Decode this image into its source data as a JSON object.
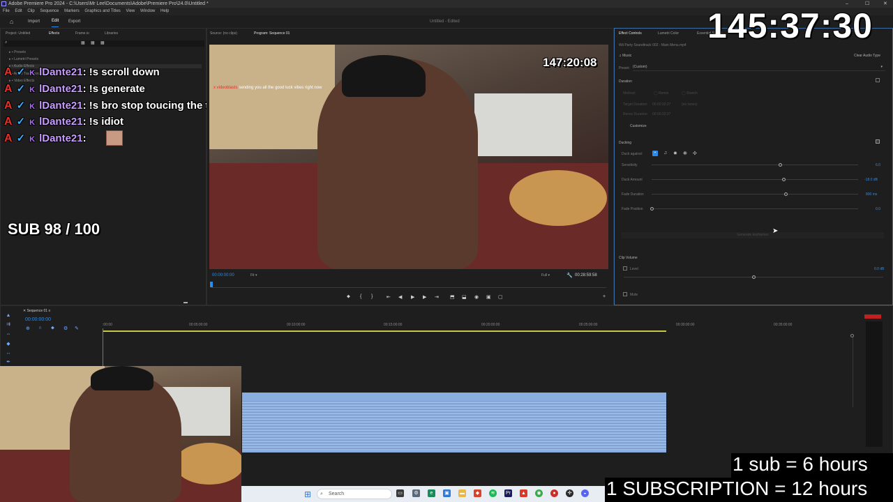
{
  "window": {
    "title": "Adobe Premiere Pro 2024 - C:\\Users\\Mr Lee\\Documents\\Adobe\\Premiere Pro\\24.0\\Untitled *",
    "controls": [
      "–",
      "☐",
      "✕"
    ]
  },
  "menu": [
    "File",
    "Edit",
    "Clip",
    "Sequence",
    "Markers",
    "Graphics and Titles",
    "View",
    "Window",
    "Help"
  ],
  "workspace": {
    "tabs": [
      "Import",
      "Edit",
      "Export"
    ],
    "active_tab": "Edit",
    "project_status": "Untitled - Edited"
  },
  "left_panel": {
    "tabs": [
      "Project: Untitled",
      "Effects",
      "Frame.io",
      "Libraries"
    ],
    "active_tab": "Effects",
    "tree": [
      "Presets",
      "Lumetri Presets",
      "Audio Effects",
      "Audio Transitions",
      "Video Effects"
    ]
  },
  "chat": [
    {
      "user": "lDante21",
      "message": "!s scroll down"
    },
    {
      "user": "lDante21",
      "message": "!s generate"
    },
    {
      "user": "lDante21",
      "message": "!s bro stop toucing the things LMAO u messed it up"
    },
    {
      "user": "lDante21",
      "message": "!s idiot"
    },
    {
      "user": "lDante21",
      "message": ""
    }
  ],
  "sub_goal": "SUB 98 / 100",
  "stream_timer": "145:37:30",
  "monitor": {
    "tabs": [
      "Source: (no clips)",
      "Program: Sequence 01"
    ],
    "active_tab": "Program: Sequence 01",
    "video_timer": "147:20:08",
    "video_alert_user": "x videoblasts",
    "video_alert_text": "sending you all the good luck vibes right now",
    "playhead_time": "00:00:00:00",
    "fit": "Fit",
    "quality": "Full",
    "duration": "00:28:59:58"
  },
  "effect_controls": {
    "tabs": [
      "Effect Controls",
      "Lumetri Color",
      "Essential Sound"
    ],
    "clip_name": "Wii Party Soundtrack 002 - Main Menu.mp4",
    "music_label": "Music",
    "clear_button": "Clear Audio Type",
    "preset_label": "Preset:",
    "preset_value": "(Custom)",
    "duration_section": "Duration",
    "method_label": "Method:",
    "method_options": [
      "Remix",
      "Stretch"
    ],
    "target_label": "Target Duration:",
    "target_value": "00:03:32:27",
    "target_note": "(no remix)",
    "remix_label": "Remix Duration:",
    "remix_value": "00:03:32:27",
    "customize_button": "Customize",
    "ducking_section": "Ducking",
    "duck_against_label": "Duck against:",
    "sliders": [
      {
        "label": "Sensitivity",
        "value": "6.0",
        "level": 0.62
      },
      {
        "label": "Duck Amount",
        "value": "-18.0",
        "unit": "dB",
        "level": 0.64
      },
      {
        "label": "Fade Duration",
        "value": "800",
        "unit": "ms",
        "level": 0.65
      },
      {
        "label": "Fade Position",
        "value": "0.0",
        "level": 0.0
      }
    ],
    "generate_button": "Generate keyframes",
    "clip_volume_section": "Clip Volume",
    "level_label": "Level",
    "level_value": "0.0",
    "level_unit": "dB",
    "level_fraction": 0.5,
    "mute_label": "Mute"
  },
  "timeline": {
    "tab": "Sequence 01",
    "timecode": "00:00:00:00",
    "ruler": [
      ":00:00",
      "00:05:00:00",
      "00:10:00:00",
      "00:15:00:00",
      "00:20:00:00",
      "00:25:00:00",
      "00:30:00:00",
      "00:35:00:00"
    ]
  },
  "taskbar": {
    "search_placeholder": "Search"
  },
  "promo": {
    "line1": "1 sub = 6 hours",
    "line2": "1 SUBSCRIPTION = 12 hours"
  },
  "colors": {
    "accent": "#2d8ceb",
    "audio_clip": "#8aaee0",
    "alert_red": "#e8302a",
    "chat_user": "#c89bff"
  }
}
